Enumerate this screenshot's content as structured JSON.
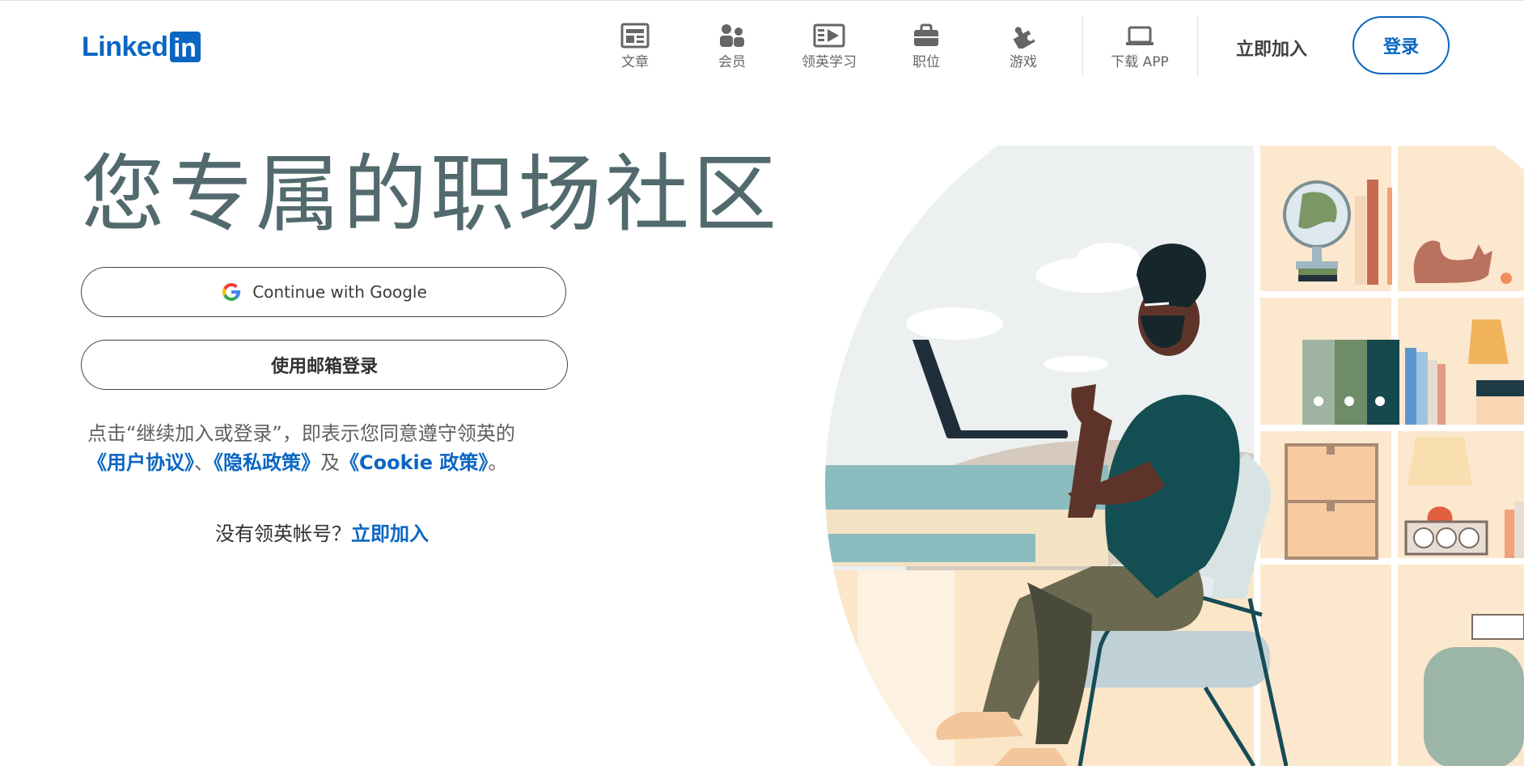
{
  "brand": {
    "logo_text": "Linked",
    "logo_box": "in",
    "color": "#0a66c2"
  },
  "nav": {
    "items": [
      {
        "label": "文章",
        "icon": "article-icon"
      },
      {
        "label": "会员",
        "icon": "people-icon"
      },
      {
        "label": "领英学习",
        "icon": "learning-video-icon"
      },
      {
        "label": "职位",
        "icon": "briefcase-icon"
      },
      {
        "label": "游戏",
        "icon": "puzzle-icon"
      },
      {
        "label": "下载 APP",
        "icon": "laptop-icon"
      }
    ],
    "join_label": "立即加入",
    "signin_label": "登录"
  },
  "hero": {
    "headline": "您专属的职场社区",
    "google_button": "Continue with Google",
    "email_button": "使用邮箱登录",
    "terms_prefix": "点击“继续加入或登录”，即表示您同意遵守领英的",
    "terms_user_agreement": "《用户协议》",
    "terms_sep": "、",
    "terms_privacy": "《隐私政策》",
    "terms_and": "及",
    "terms_cookie": "《Cookie 政策》",
    "terms_end": "。",
    "no_account": "没有领英帐号？",
    "join_now": "立即加入"
  }
}
